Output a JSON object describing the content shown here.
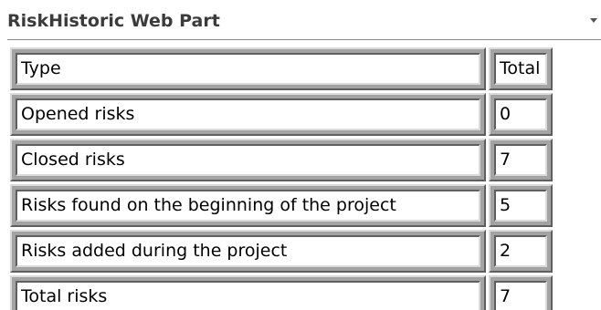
{
  "webpart": {
    "title": "RiskHistoric Web Part",
    "menu_icon": "chevron-down-icon"
  },
  "table": {
    "header": {
      "type": "Type",
      "total": "Total"
    },
    "rows": [
      {
        "type": "Opened risks",
        "total": "0"
      },
      {
        "type": "Closed risks",
        "total": "7"
      },
      {
        "type": "Risks found on the beginning of the project",
        "total": "5"
      },
      {
        "type": "Risks added during the project",
        "total": "2"
      },
      {
        "type": "Total risks",
        "total": "7"
      }
    ]
  }
}
